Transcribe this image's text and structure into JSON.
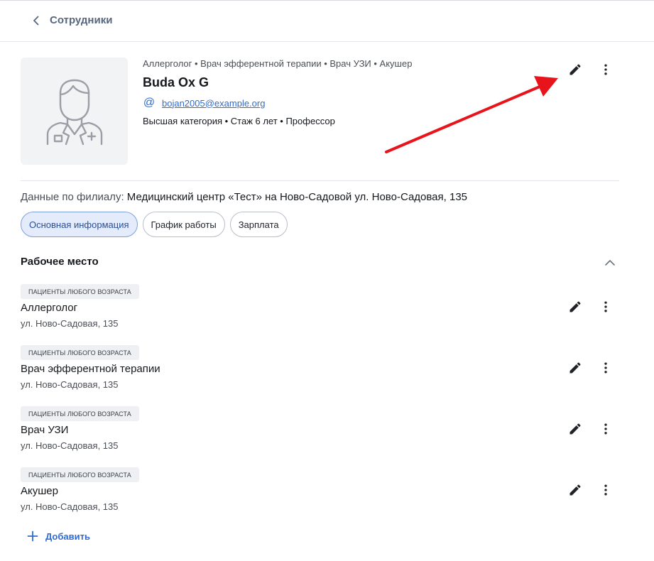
{
  "header": {
    "back_label": "Сотрудники"
  },
  "profile": {
    "specialties": "Аллерголог • Врач эфферентной терапии • Врач УЗИ • Акушер",
    "name": "Buda Ox G",
    "email_icon": "@",
    "email": "bojan2005@example.org",
    "meta": "Высшая категория • Стаж 6 лет • Профессор"
  },
  "branch": {
    "label": "Данные по филиалу:",
    "value": "Медицинский центр «Тест» на Ново-Садовой ул. Ново-Садовая, 135"
  },
  "tabs": [
    {
      "label": "Основная информация",
      "active": true
    },
    {
      "label": "График работы",
      "active": false
    },
    {
      "label": "Зарплата",
      "active": false
    }
  ],
  "workplace_section": {
    "title": "Рабочее место",
    "items": [
      {
        "badge": "ПАЦИЕНТЫ ЛЮБОГО ВОЗРАСТА",
        "title": "Аллерголог",
        "address": "ул. Ново-Садовая, 135"
      },
      {
        "badge": "ПАЦИЕНТЫ ЛЮБОГО ВОЗРАСТА",
        "title": "Врач эфферентной терапии",
        "address": "ул. Ново-Садовая, 135"
      },
      {
        "badge": "ПАЦИЕНТЫ ЛЮБОГО ВОЗРАСТА",
        "title": "Врач УЗИ",
        "address": "ул. Ново-Садовая, 135"
      },
      {
        "badge": "ПАЦИЕНТЫ ЛЮБОГО ВОЗРАСТА",
        "title": "Акушер",
        "address": "ул. Ново-Садовая, 135"
      }
    ],
    "add_label": "Добавить"
  },
  "colors": {
    "accent": "#2f6bd1",
    "active_tab_bg": "#e4ecfb",
    "annotation_arrow": "#e8141c"
  },
  "icons": {
    "back": "chevron-left-icon",
    "avatar": "doctor-avatar-icon",
    "email": "at-sign-icon",
    "edit": "pencil-icon",
    "more": "more-vertical-icon",
    "collapse": "chevron-up-icon",
    "add": "plus-icon"
  }
}
